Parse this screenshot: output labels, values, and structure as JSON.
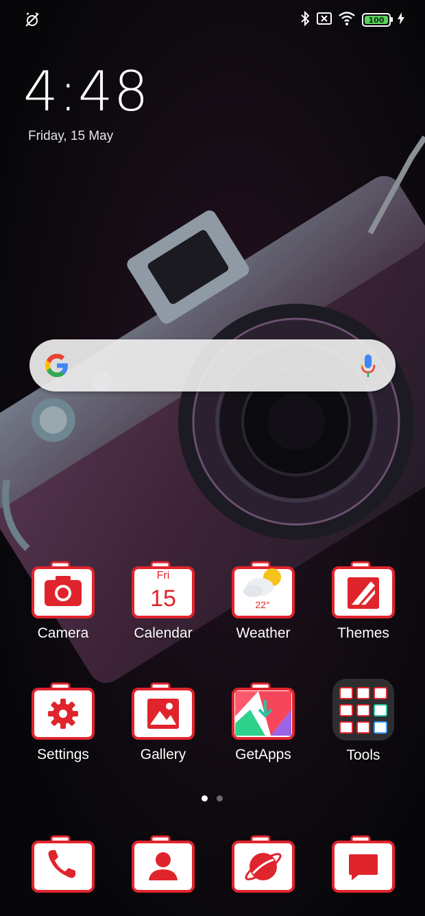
{
  "status_bar": {
    "left_icon": "alarm-off-icon",
    "right_icons": [
      "bluetooth-icon",
      "no-sim-icon",
      "wifi-icon"
    ],
    "battery_level": "100",
    "charging_icon": "charging-bolt-icon"
  },
  "lockscreen": {
    "time": "4:48",
    "date": "Friday, 15 May"
  },
  "search_bar": {
    "logo": "google-g-icon",
    "voice_icon": "mic-icon"
  },
  "apps_row1": [
    {
      "label": "Camera"
    },
    {
      "label": "Calendar",
      "day": "Fri",
      "date": "15"
    },
    {
      "label": "Weather",
      "temp": "22°"
    },
    {
      "label": "Themes"
    }
  ],
  "apps_row2": [
    {
      "label": "Settings"
    },
    {
      "label": "Gallery"
    },
    {
      "label": "GetApps"
    },
    {
      "label": "Tools"
    }
  ],
  "dock": [
    {
      "icon": "phone-icon"
    },
    {
      "icon": "contacts-icon"
    },
    {
      "icon": "browser-icon"
    },
    {
      "icon": "messages-icon"
    }
  ],
  "page_indicator": {
    "pages": 2,
    "active": 1
  },
  "colors": {
    "accent": "#e0242c",
    "battery_green": "#56d35c",
    "background": "#07070a"
  }
}
